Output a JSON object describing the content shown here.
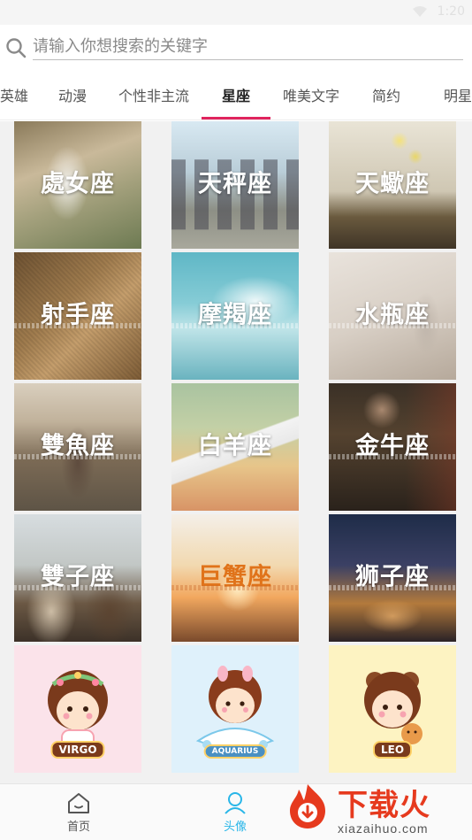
{
  "status": {
    "time": "1:20"
  },
  "search": {
    "placeholder": "请输入你想搜索的关键字"
  },
  "tabs": [
    {
      "label": "英雄"
    },
    {
      "label": "动漫"
    },
    {
      "label": "个性非主流"
    },
    {
      "label": "星座",
      "active": true
    },
    {
      "label": "唯美文字"
    },
    {
      "label": "简约"
    },
    {
      "label": "明星"
    }
  ],
  "tiles": [
    {
      "title": "處女座",
      "theme": "girl-with-bag"
    },
    {
      "title": "天秤座",
      "theme": "friends-walking"
    },
    {
      "title": "天蠍座",
      "theme": "flower-book"
    },
    {
      "title": "射手座",
      "theme": "burlap-bag"
    },
    {
      "title": "摩羯座",
      "theme": "blue-sky"
    },
    {
      "title": "水瓶座",
      "theme": "glass-jars"
    },
    {
      "title": "雙魚座",
      "theme": "couple-walking"
    },
    {
      "title": "白羊座",
      "theme": "airplane"
    },
    {
      "title": "金牛座",
      "theme": "man-with-bag"
    },
    {
      "title": "雙子座",
      "theme": "two-girls"
    },
    {
      "title": "巨蟹座",
      "theme": "sunset-girl"
    },
    {
      "title": "狮子座",
      "theme": "hands-light"
    },
    {
      "title": "",
      "badge": "VIRGO",
      "theme": "cartoon-virgo"
    },
    {
      "title": "",
      "badge": "AQUARIUS",
      "theme": "cartoon-aquarius"
    },
    {
      "title": "",
      "badge": "LEO",
      "theme": "cartoon-leo"
    }
  ],
  "bottom_nav": [
    {
      "label": "首页",
      "icon": "home-icon"
    },
    {
      "label": "头像",
      "icon": "avatar-icon",
      "active": true
    }
  ],
  "watermark": {
    "brand": "下载火",
    "url": "xiazaihuo.com"
  },
  "colors": {
    "accent": "#e0245e",
    "nav_active": "#29b6e8",
    "brand": "#e63a1e"
  }
}
